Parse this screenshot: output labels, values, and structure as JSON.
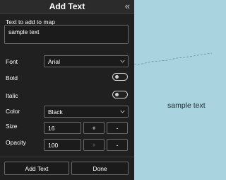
{
  "panel": {
    "title": "Add Text",
    "text_label": "Text to add to map",
    "text_value": "sample text",
    "font_label": "Font",
    "font_value": "Arial",
    "bold_label": "Bold",
    "bold_on": false,
    "italic_label": "Italic",
    "italic_on": false,
    "color_label": "Color",
    "color_value": "Black",
    "size_label": "Size",
    "size_value": "16",
    "opacity_label": "Opacity",
    "opacity_value": "100",
    "plus": "+",
    "minus": "-",
    "add_button": "Add Text",
    "done_button": "Done",
    "collapse_glyph": "«"
  },
  "map": {
    "label": "sample text"
  },
  "colors": {
    "panel_bg": "#202020",
    "map_water": "#a9d3df",
    "border": "#6a6a6a"
  },
  "icons": [
    "collapse-icon",
    "chevron-down-icon"
  ]
}
